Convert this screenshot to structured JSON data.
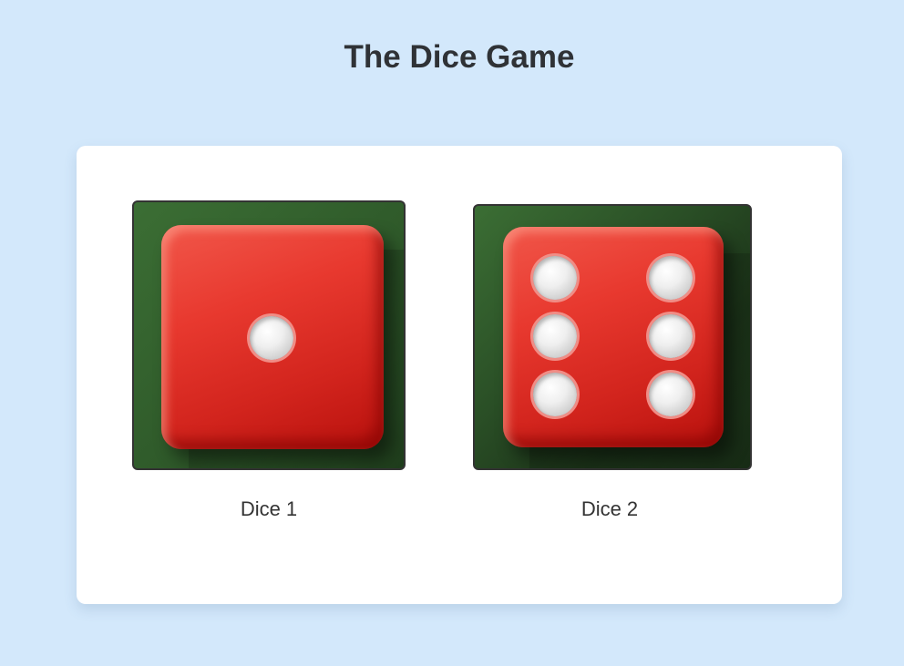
{
  "page": {
    "title": "The Dice Game",
    "background": "#d3e8fb"
  },
  "dice": [
    {
      "label": "Dice 1",
      "value": 1,
      "color": "#e8392f",
      "table_color": "#2f5a2a"
    },
    {
      "label": "Dice 2",
      "value": 6,
      "color": "#e8392f",
      "table_color": "#2f5a2a"
    }
  ]
}
